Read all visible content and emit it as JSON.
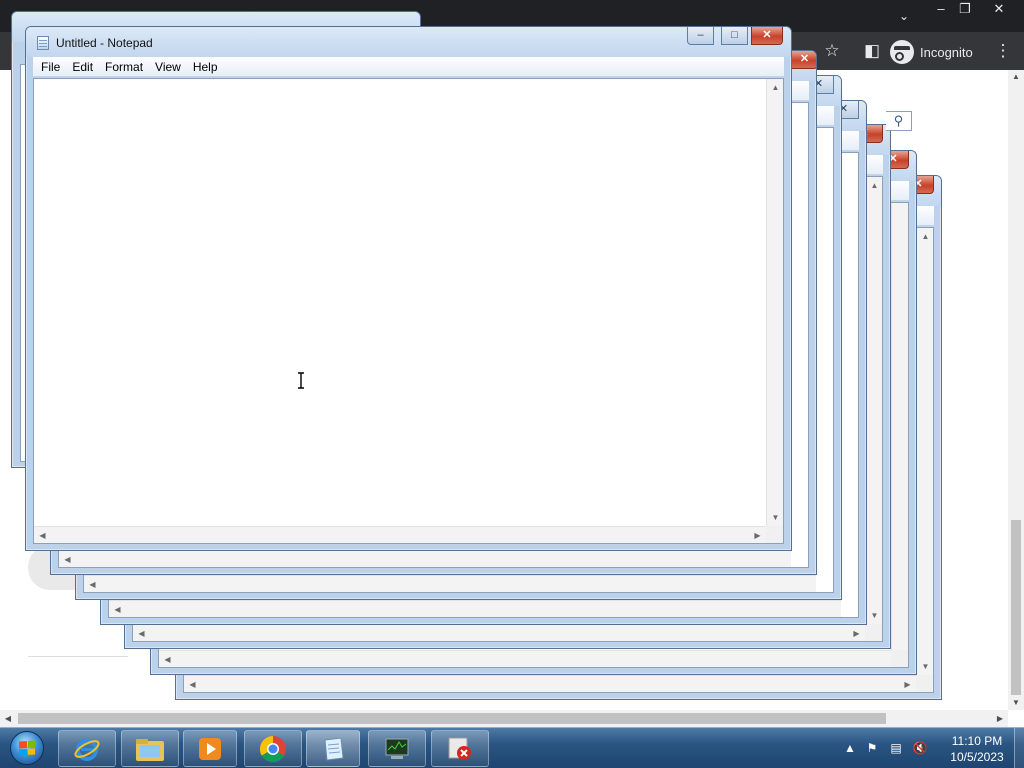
{
  "chrome": {
    "incognito_label": "Incognito",
    "icons": [
      "tab-search-icon",
      "minimize-icon",
      "restore-icon",
      "close-icon",
      "bookmark-star-icon",
      "side-panel-icon",
      "incognito-icon",
      "more-menu-icon"
    ]
  },
  "main_notepad": {
    "title": "Untitled - Notepad",
    "menu": [
      "File",
      "Edit",
      "Format",
      "View",
      "Help"
    ],
    "content": ""
  },
  "taskbar": {
    "pinned": [
      {
        "name": "internet-explorer",
        "label": "Internet Explorer"
      },
      {
        "name": "windows-explorer",
        "label": "Windows Explorer"
      },
      {
        "name": "media-player",
        "label": "Windows Media Player"
      },
      {
        "name": "chrome",
        "label": "Google Chrome"
      },
      {
        "name": "notepad",
        "label": "Notepad"
      },
      {
        "name": "task-manager",
        "label": "Task Manager"
      },
      {
        "name": "error-app",
        "label": "Error"
      }
    ],
    "clock": {
      "time": "11:10 PM",
      "date": "10/5/2023"
    },
    "tray_icons": [
      "show-hidden-icons",
      "action-center-flag-icon",
      "network-icon",
      "volume-muted-icon"
    ]
  },
  "colors": {
    "chrome_dark": "#202124",
    "chrome_toolbar": "#35363a",
    "window_frame": "#bcd2ea",
    "close_button": "#c8412a",
    "taskbar": "#2a5582"
  }
}
